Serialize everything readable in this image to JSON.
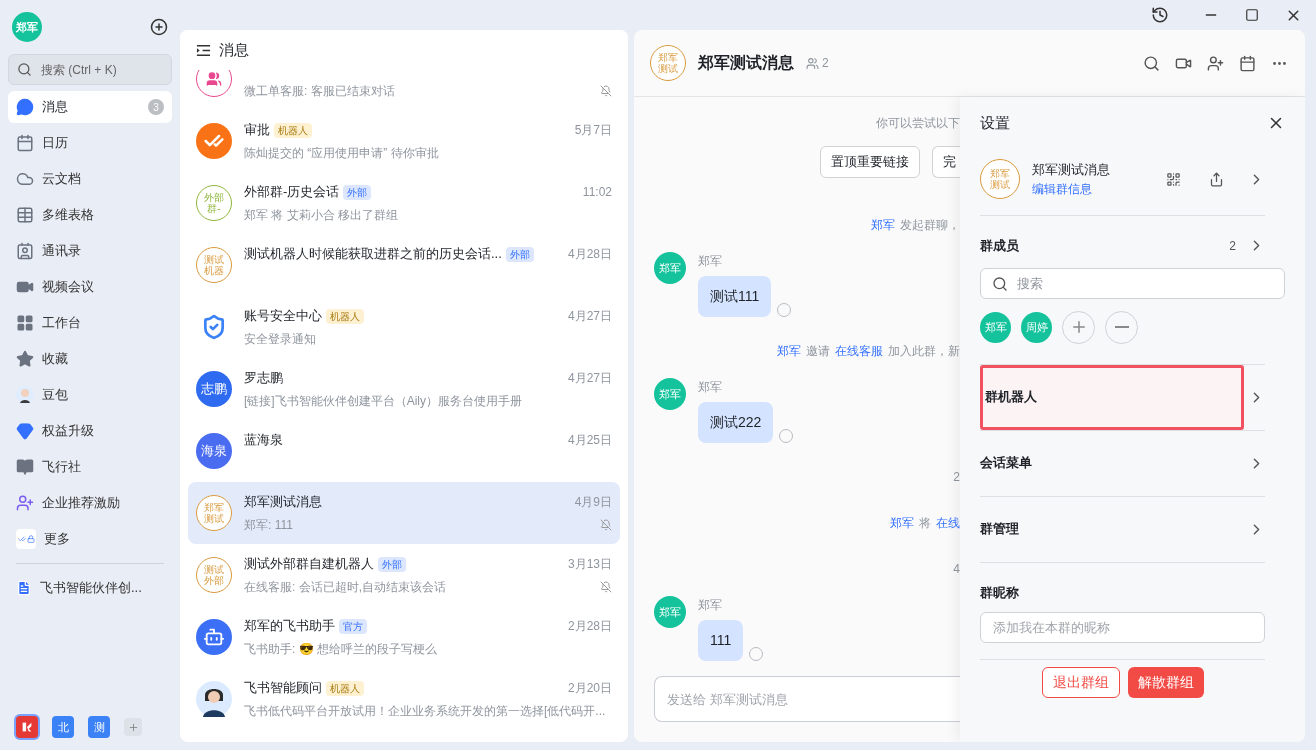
{
  "sidebar": {
    "user_avatar": "郑军",
    "search": {
      "placeholder": "搜索 (Ctrl + K)"
    },
    "items": [
      {
        "label": "消息",
        "badge": "3",
        "selected": true
      },
      {
        "label": "日历",
        "selected": false
      },
      {
        "label": "云文档",
        "selected": false
      },
      {
        "label": "多维表格",
        "selected": false
      },
      {
        "label": "通讯录",
        "selected": false
      },
      {
        "label": "视频会议",
        "selected": false
      },
      {
        "label": "工作台",
        "selected": false
      },
      {
        "label": "收藏",
        "selected": false
      },
      {
        "label": "豆包",
        "selected": false
      },
      {
        "label": "权益升级",
        "selected": false
      },
      {
        "label": "飞行社",
        "selected": false
      },
      {
        "label": "企业推荐激励",
        "selected": false
      },
      {
        "label": "更多",
        "selected": false
      }
    ],
    "pinned": [
      {
        "label": "飞书智能伙伴创..."
      }
    ],
    "tenants": [
      {
        "kind": "logo",
        "selected": true
      },
      {
        "kind": "text",
        "text": "北",
        "selected": false
      },
      {
        "kind": "text",
        "text": "测",
        "selected": false
      }
    ]
  },
  "chat_list": {
    "title": "消息",
    "chats": [
      {
        "avatar": {
          "kind": "group_icon",
          "color": "#e8488f"
        },
        "preview": "微工单客服: 客服已结束对话",
        "muted": true,
        "selected": false
      },
      {
        "avatar": {
          "kind": "approval",
          "color": "#f97316"
        },
        "title": "审批",
        "tag": {
          "kind": "robot",
          "text": "机器人"
        },
        "time": "5月7日",
        "preview": "陈灿提交的 “应用使用申请” 待你审批",
        "muted": false,
        "selected": false
      },
      {
        "avatar": {
          "kind": "ring",
          "color": "#8fb63a",
          "lines": [
            "外部",
            "群-"
          ]
        },
        "title": "外部群-历史会话",
        "tag": {
          "kind": "external",
          "text": "外部"
        },
        "time": "11:02",
        "preview": "郑军 将 艾莉小合 移出了群组",
        "muted": false,
        "selected": false
      },
      {
        "avatar": {
          "kind": "ring",
          "color": "#d99a3d",
          "lines": [
            "测试",
            "机器"
          ]
        },
        "title": "测试机器人时候能获取进群之前的历史会话...",
        "tag": {
          "kind": "external",
          "text": "外部"
        },
        "time": "4月28日",
        "muted": false,
        "selected": false
      },
      {
        "avatar": {
          "kind": "shield",
          "color": "#3b82f6"
        },
        "title": "账号安全中心",
        "tag": {
          "kind": "robot",
          "text": "机器人"
        },
        "time": "4月27日",
        "preview": "安全登录通知",
        "muted": false,
        "selected": false
      },
      {
        "avatar": {
          "kind": "solid",
          "color": "#2f6bf0",
          "lines": [
            "志鹏"
          ]
        },
        "title": "罗志鹏",
        "time": "4月27日",
        "preview": "[链接]飞书智能伙伴创建平台（Aily）服务台使用手册",
        "muted": false,
        "selected": false
      },
      {
        "avatar": {
          "kind": "solid",
          "color": "#4a6cf0",
          "lines": [
            "海泉"
          ]
        },
        "title": "蓝海泉",
        "time": "4月25日",
        "muted": false,
        "selected": false
      },
      {
        "avatar": {
          "kind": "ring",
          "color": "#d99a3d",
          "lines": [
            "郑军",
            "测试"
          ]
        },
        "title": "郑军测试消息",
        "time": "4月9日",
        "preview": "郑军: 111",
        "muted": true,
        "selected": true
      },
      {
        "avatar": {
          "kind": "ring",
          "color": "#d99a3d",
          "lines": [
            "测试",
            "外部"
          ]
        },
        "title": "测试外部群自建机器人",
        "tag": {
          "kind": "external",
          "text": "外部"
        },
        "time": "3月13日",
        "preview": "在线客服: 会话已超时,自动结束该会话",
        "muted": true,
        "selected": false
      },
      {
        "avatar": {
          "kind": "robot",
          "color": "#3b6ff5"
        },
        "title": "郑军的飞书助手",
        "tag": {
          "kind": "official",
          "text": "官方"
        },
        "time": "2月28日",
        "preview": "飞书助手: 😎 想给呼兰的段子写梗么",
        "muted": false,
        "selected": false
      },
      {
        "avatar": {
          "kind": "person",
          "color": "#dbeafe"
        },
        "title": "飞书智能顾问",
        "tag": {
          "kind": "robot",
          "text": "机器人"
        },
        "time": "2月20日",
        "preview": "飞书低代码平台开放试用！企业业务系统开发的第一选择[低代码开...",
        "muted": false,
        "selected": false
      }
    ]
  },
  "chat": {
    "avatar": [
      "郑军",
      "测试"
    ],
    "title": "郑军测试消息",
    "member_count": "2",
    "items": [
      {
        "kind": "system",
        "parts": [
          {
            "text": "你可以尝试以下",
            "link": false
          }
        ]
      },
      {
        "kind": "actions",
        "buttons": [
          "置顶重要链接",
          "完"
        ]
      },
      {
        "kind": "system",
        "parts": [
          {
            "text": "郑军",
            "link": true
          },
          {
            "text": "发起群聊，",
            "link": false
          }
        ]
      },
      {
        "kind": "message",
        "sender": "郑军",
        "avatar": "郑军",
        "text": "测试111"
      },
      {
        "kind": "system",
        "parts": [
          {
            "text": "郑军",
            "link": true
          },
          {
            "text": "邀请",
            "link": false
          },
          {
            "text": "在线客服",
            "link": true
          },
          {
            "text": "加入此群，新",
            "link": false
          }
        ]
      },
      {
        "kind": "message",
        "sender": "郑军",
        "avatar": "郑军",
        "text": "测试222"
      },
      {
        "kind": "system",
        "parts": [
          {
            "text": "2",
            "link": false
          }
        ]
      },
      {
        "kind": "system",
        "parts": [
          {
            "text": "郑军",
            "link": true
          },
          {
            "text": "将",
            "link": false
          },
          {
            "text": "在线",
            "link": true
          }
        ]
      },
      {
        "kind": "system",
        "parts": [
          {
            "text": "4",
            "link": false
          }
        ]
      },
      {
        "kind": "message",
        "sender": "郑军",
        "avatar": "郑军",
        "text": "111"
      }
    ],
    "input": {
      "placeholder": "发送给 郑军测试消息"
    }
  },
  "settings": {
    "title": "设置",
    "group": {
      "avatar": [
        "郑军",
        "测试"
      ],
      "name": "郑军测试消息",
      "edit_link": "编辑群信息"
    },
    "members": {
      "label": "群成员",
      "count": "2",
      "search_placeholder": "搜索",
      "people": [
        "郑军",
        "周婷"
      ]
    },
    "rows": [
      {
        "label": "群机器人",
        "highlighted": true
      },
      {
        "label": "会话菜单",
        "highlighted": false
      },
      {
        "label": "群管理",
        "highlighted": false
      }
    ],
    "nickname": {
      "label": "群昵称",
      "placeholder": "添加我在本群的昵称"
    },
    "buttons": [
      {
        "kind": "outline",
        "text": "退出群组"
      },
      {
        "kind": "danger",
        "text": "解散群组"
      }
    ]
  }
}
